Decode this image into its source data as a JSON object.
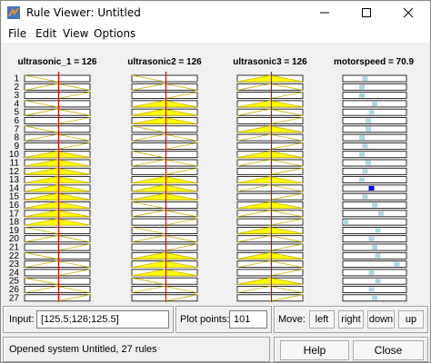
{
  "window": {
    "title": "Rule Viewer: Untitled"
  },
  "menu": {
    "items": [
      "File",
      "Edit",
      "View",
      "Options"
    ]
  },
  "plots": {
    "inputs": [
      {
        "title": "ultrasonic_1 = 126",
        "value_frac": 0.52
      },
      {
        "title": "ultrasonic2 = 126",
        "value_frac": 0.52
      },
      {
        "title": "ultrasonic3 = 126",
        "value_frac": 0.52
      }
    ],
    "output": {
      "title": "motorspeed = 70.9"
    },
    "rule_numbers": [
      "1",
      "2",
      "3",
      "4",
      "5",
      "6",
      "7",
      "8",
      "9",
      "10",
      "11",
      "12",
      "13",
      "14",
      "15",
      "16",
      "17",
      "18",
      "19",
      "20",
      "21",
      "22",
      "23",
      "24",
      "25",
      "26",
      "27"
    ],
    "fire": {
      "in1": [
        0,
        0,
        0,
        0,
        0,
        0,
        0,
        0,
        0,
        1,
        1,
        1,
        1,
        1,
        1,
        1,
        1,
        1,
        0,
        0,
        0,
        0,
        0,
        0,
        0,
        0,
        0
      ],
      "in2": [
        0,
        0,
        0,
        1,
        1,
        1,
        0,
        0,
        0,
        0,
        0,
        0,
        1,
        1,
        1,
        0,
        0,
        0,
        0,
        0,
        0,
        1,
        1,
        1,
        0,
        0,
        0
      ],
      "in3": [
        1,
        0,
        0,
        1,
        0,
        0,
        1,
        0,
        0,
        1,
        0,
        0,
        1,
        0,
        0,
        1,
        0,
        0,
        1,
        0,
        0,
        1,
        0,
        0,
        1,
        0,
        0
      ]
    },
    "output_marks": [
      0.35,
      0.3,
      0.3,
      0.5,
      0.45,
      0.4,
      0.4,
      0.3,
      0.35,
      0.3,
      0.4,
      0.35,
      0.3,
      0.45,
      0.35,
      0.5,
      0.6,
      0.0,
      0.55,
      0.45,
      0.5,
      0.55,
      0.85,
      0.45,
      0.55,
      0.45,
      0.5
    ],
    "output_active_rule": 14
  },
  "controls": {
    "input_label": "Input:",
    "input_value": "[125.5;126;125.5]",
    "points_label": "Plot points:",
    "points_value": "101",
    "move_label": "Move:",
    "move_buttons": [
      "left",
      "right",
      "down",
      "up"
    ],
    "status": "Opened system Untitled, 27 rules",
    "help_label": "Help",
    "close_label": "Close"
  },
  "colors": {
    "fill": "#ffff00",
    "line": "#c8b400",
    "red_line": "#e00000",
    "output_mark": "#a8d8e0",
    "output_active": "#0000ff"
  }
}
